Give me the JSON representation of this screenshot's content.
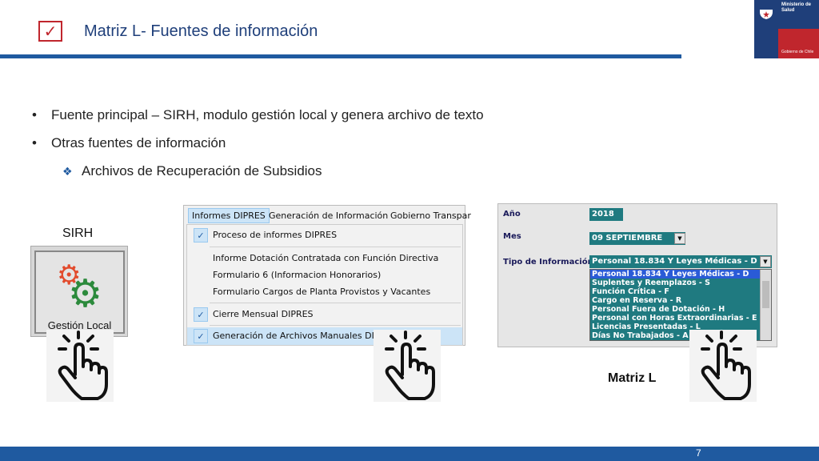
{
  "header": {
    "title": "Matriz L- Fuentes de información",
    "check_glyph": "✓",
    "logo_line1": "Ministerio de Salud",
    "logo_line2": "Gobierno de Chile"
  },
  "bullets": [
    "Fuente principal – SIRH, modulo gestión local y genera archivo de texto",
    "Otras fuentes de información",
    "Archivos de Recuperación de Subsidios"
  ],
  "sirh": {
    "label": "SIRH",
    "button_label": "Gestión Local"
  },
  "menu": {
    "bar": [
      "Informes DIPRES",
      "Generación de Información",
      "Gobierno Transpar"
    ],
    "items": [
      {
        "label": "Proceso de informes DIPRES",
        "checked": true
      },
      {
        "label": "Informe Dotación Contratada con Función Directiva",
        "checked": false
      },
      {
        "label": "Formulario 6 (Informacion Honorarios)",
        "checked": false
      },
      {
        "label": "Formulario Cargos de Planta Provistos y Vacantes",
        "checked": false
      },
      {
        "label": "Cierre Mensual DIPRES",
        "checked": true
      },
      {
        "label": "Generación de Archivos Manuales DIPRES",
        "checked": true
      }
    ],
    "check_glyph": "✓"
  },
  "matriz": {
    "labels": {
      "year": "Año",
      "month": "Mes",
      "type": "Tipo de Información"
    },
    "year": "2018",
    "month": "09 SEPTIEMBRE",
    "type_selected": "Personal 18.834 Y Leyes Médicas - D",
    "options": [
      "Personal 18.834 Y Leyes Médicas - D",
      "Suplentes y Reemplazos - S",
      "Función Crítica - F",
      "Cargo en Reserva - R",
      "Personal Fuera de Dotación - H",
      "Personal con Horas Extraordinarias - E",
      "Licencias Presentadas - L",
      "Días No Trabajados - A"
    ],
    "caption": "Matriz L"
  },
  "footer": {
    "page": "7"
  },
  "colors": {
    "accent": "#1f5aa0",
    "red": "#c0262d",
    "teal": "#1f7a80"
  },
  "icons": [
    "check-icon",
    "gear-icon",
    "pointing-hand-icon",
    "chevron-down-icon"
  ]
}
